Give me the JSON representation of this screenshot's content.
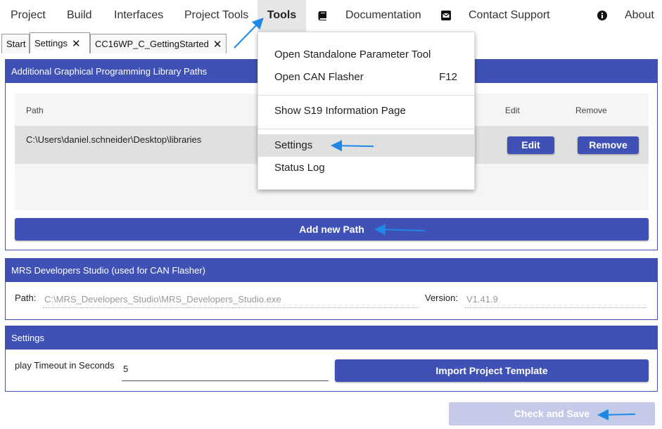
{
  "menubar": {
    "items": [
      {
        "label": "Project"
      },
      {
        "label": "Build"
      },
      {
        "label": "Interfaces"
      },
      {
        "label": "Project Tools"
      },
      {
        "label": "Tools"
      },
      {
        "label": "Documentation",
        "icon": "book-icon"
      },
      {
        "label": "Contact Support",
        "icon": "mail-icon"
      },
      {
        "label": "About",
        "icon": "info-icon"
      }
    ]
  },
  "tabs": [
    {
      "label": "Start",
      "closable": false
    },
    {
      "label": "Settings",
      "closable": true,
      "active": true
    },
    {
      "label": "CC16WP_C_GettingStarted",
      "closable": true
    }
  ],
  "tab_close_glyph": "✕",
  "libs_panel": {
    "title": "Additional Graphical Programming Library Paths",
    "columns": {
      "path": "Path",
      "edit": "Edit",
      "remove": "Remove"
    },
    "rows": [
      {
        "path": "C:\\Users\\daniel.schneider\\Desktop\\libraries",
        "edit_label": "Edit",
        "remove_label": "Remove"
      }
    ],
    "add_button": "Add new Path"
  },
  "mrs_panel": {
    "title": "MRS Developers Studio (used for CAN Flasher)",
    "path_label": "Path:",
    "path_value": "C:\\MRS_Developers_Studio\\MRS_Developers_Studio.exe",
    "version_label": "Version:",
    "version_value": "V1.41.9"
  },
  "settings_panel": {
    "title": "Settings",
    "timeout_label": "play Timeout in Seconds",
    "timeout_value": "5",
    "import_button": "Import Project Template"
  },
  "check_save_button": "Check and Save",
  "tools_menu": {
    "items": [
      {
        "label": "Open Standalone Parameter Tool",
        "shortcut": ""
      },
      {
        "label": "Open CAN Flasher",
        "shortcut": "F12"
      },
      {
        "label": "Show S19 Information Page",
        "shortcut": ""
      },
      {
        "label": "Settings",
        "shortcut": "",
        "highlighted": true
      },
      {
        "label": "Status Log",
        "shortcut": ""
      }
    ]
  },
  "colors": {
    "primary": "#3f51b5",
    "primary_disabled": "#c5cae9",
    "annotation_arrow": "#1e88e5",
    "active_menu_bg": "#e6e6e6"
  }
}
